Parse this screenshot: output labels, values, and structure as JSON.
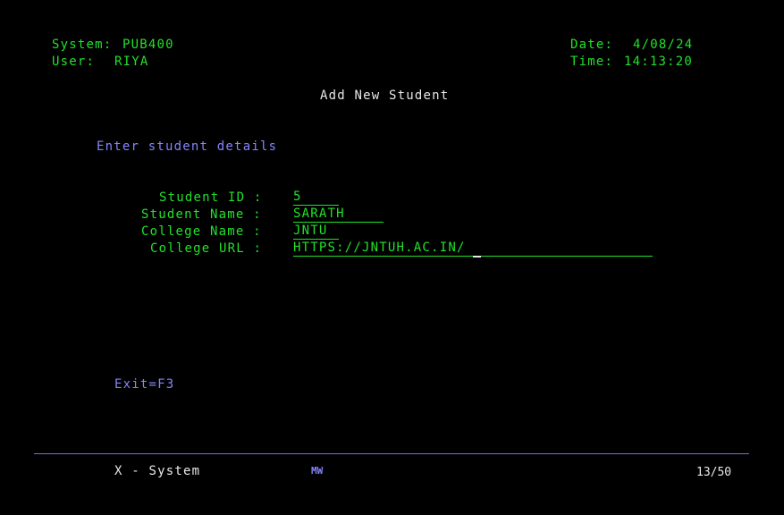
{
  "header": {
    "system_label": "System:",
    "system_value": "PUB400",
    "user_label": "User:",
    "user_value": "RIYA",
    "date_label": "Date:",
    "date_value": "4/08/24",
    "time_label": "Time:",
    "time_value": "14:13:20"
  },
  "screen_title": "Add New Student",
  "instruction": "Enter student details",
  "form": {
    "student_id": {
      "label": "Student ID :",
      "value": "5"
    },
    "student_name": {
      "label": "Student Name :",
      "value": "SARATH"
    },
    "college_name": {
      "label": "College Name :",
      "value": "JNTU"
    },
    "college_url": {
      "label": "College URL :",
      "value": "HTTPS://JNTUH.AC.IN/"
    }
  },
  "function_keys": {
    "exit": "Exit=F3"
  },
  "status_bar": {
    "session": "X - System",
    "mode": "MW",
    "cursor_position": "13/50"
  },
  "colors": {
    "background": "#000000",
    "field_green": "#22e12a",
    "label_blue": "#8585ff",
    "text_white": "#e8e8e8"
  }
}
